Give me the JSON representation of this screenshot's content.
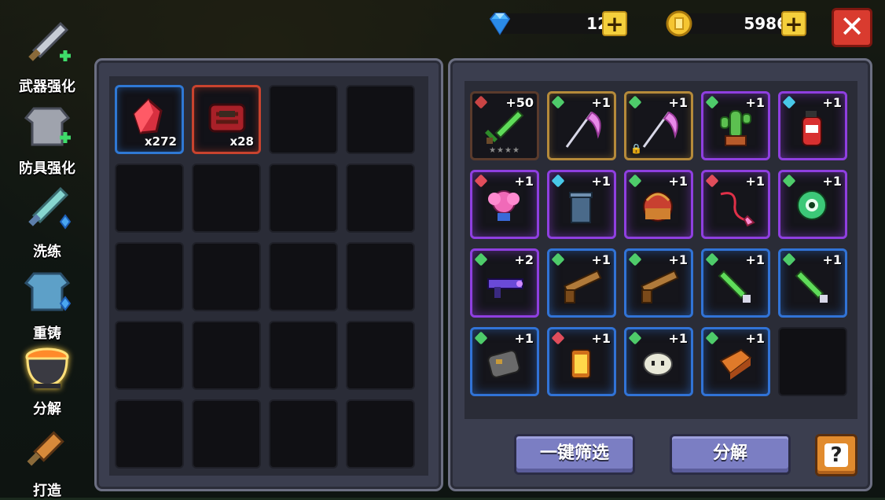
{
  "currencies": {
    "gems": {
      "value": "12",
      "icon": "diamond-icon"
    },
    "coins": {
      "value": "5986",
      "icon": "coin-icon"
    },
    "plus_label": "+",
    "close_label": "✕"
  },
  "sidebar": [
    {
      "label": "武器强化",
      "icon": "sword-upgrade-icon",
      "active": false
    },
    {
      "label": "防具强化",
      "icon": "armor-upgrade-icon",
      "active": false
    },
    {
      "label": "洗练",
      "icon": "refine-icon",
      "active": false
    },
    {
      "label": "重铸",
      "icon": "recast-icon",
      "active": false
    },
    {
      "label": "分解",
      "icon": "cauldron-icon",
      "active": true
    },
    {
      "label": "打造",
      "icon": "forge-icon",
      "active": false
    }
  ],
  "materials": [
    {
      "name": "red-crystal",
      "count": "x272",
      "rarity": "blue"
    },
    {
      "name": "red-ore-chest",
      "count": "x28",
      "rarity": "red"
    }
  ],
  "items": [
    {
      "icon": "green-sword-icon",
      "level": "+50",
      "rarity": "brown",
      "gem": "#c94444",
      "stars": "★★★★"
    },
    {
      "icon": "scythe-icon",
      "level": "+1",
      "rarity": "gold",
      "gem": "#4ecb6a"
    },
    {
      "icon": "scythe-icon",
      "level": "+1",
      "rarity": "gold",
      "gem": "#4ecb6a",
      "locked": true
    },
    {
      "icon": "cactus-icon",
      "level": "+1",
      "rarity": "purple",
      "gem": "#4ecb6a"
    },
    {
      "icon": "fire-extinguisher-icon",
      "level": "+1",
      "rarity": "purple",
      "gem": "#48c8e8"
    },
    {
      "icon": "pink-flower-icon",
      "level": "+1",
      "rarity": "purple",
      "gem": "#e04d5b"
    },
    {
      "icon": "trash-can-icon",
      "level": "+1",
      "rarity": "purple",
      "gem": "#48c8e8"
    },
    {
      "icon": "basket-icon",
      "level": "+1",
      "rarity": "purple",
      "gem": "#4ecb6a"
    },
    {
      "icon": "whip-icon",
      "level": "+1",
      "rarity": "purple",
      "gem": "#e04d5b"
    },
    {
      "icon": "eye-orb-icon",
      "level": "+1",
      "rarity": "purple",
      "gem": "#4ecb6a"
    },
    {
      "icon": "purple-gun-icon",
      "level": "+2",
      "rarity": "purple",
      "gem": "#4ecb6a"
    },
    {
      "icon": "shotgun-icon",
      "level": "+1",
      "rarity": "blue",
      "gem": "#4ecb6a"
    },
    {
      "icon": "shotgun-icon",
      "level": "+1",
      "rarity": "blue",
      "gem": "#4ecb6a"
    },
    {
      "icon": "green-dagger-icon",
      "level": "+1",
      "rarity": "blue",
      "gem": "#4ecb6a"
    },
    {
      "icon": "green-dagger-icon",
      "level": "+1",
      "rarity": "blue",
      "gem": "#4ecb6a"
    },
    {
      "icon": "stone-icon",
      "level": "+1",
      "rarity": "blue",
      "gem": "#4ecb6a"
    },
    {
      "icon": "lantern-icon",
      "level": "+1",
      "rarity": "blue",
      "gem": "#e04d5b"
    },
    {
      "icon": "ghost-blob-icon",
      "level": "+1",
      "rarity": "blue",
      "gem": "#4ecb6a"
    },
    {
      "icon": "brick-icon",
      "level": "+1",
      "rarity": "blue",
      "gem": "#4ecb6a"
    },
    {
      "icon": "",
      "level": "",
      "rarity": "empty"
    }
  ],
  "buttons": {
    "filter": "一键筛选",
    "dismantle": "分解",
    "help": "?"
  }
}
